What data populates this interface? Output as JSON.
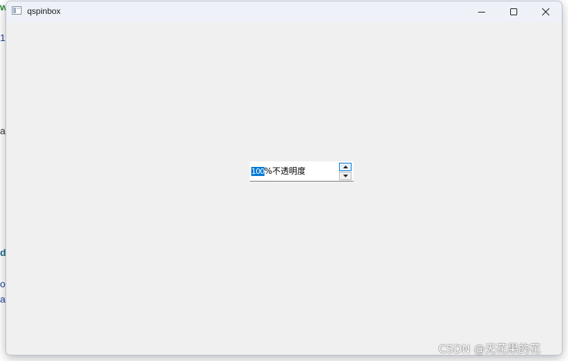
{
  "background_fragments": [
    {
      "text": "w",
      "color": "#2e8b3a"
    },
    {
      "text": "1",
      "color": "#1f3f9a"
    },
    {
      "text": "a",
      "color": "#333333"
    },
    {
      "text": "d",
      "color": "#1d6a8a"
    },
    {
      "text": "o",
      "color": "#1f3f9a"
    },
    {
      "text": "a",
      "color": "#1f3f9a"
    }
  ],
  "window": {
    "title": "qspinbox",
    "icon": "app-window-icon",
    "controls": {
      "minimize": "minimize-icon",
      "maximize": "maximize-icon",
      "close": "close-icon"
    }
  },
  "spinbox": {
    "value": "100",
    "suffix": "%不透明度",
    "selected_text": "100",
    "up_icon": "arrow-up-icon",
    "down_icon": "arrow-down-icon"
  },
  "watermark": "CSDN @无花果的花",
  "colors": {
    "client_bg": "#f0f0f0",
    "selection": "#0078d7",
    "titlebar": "#eef2f8"
  }
}
